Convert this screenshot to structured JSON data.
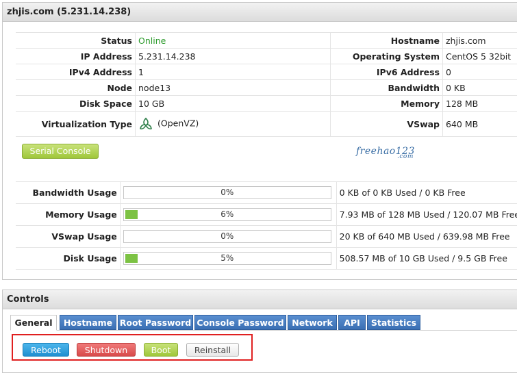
{
  "server_panel": {
    "title": "zhjis.com (5.231.14.238)"
  },
  "info": {
    "rows": [
      {
        "l1": "Status",
        "v1": "Online",
        "l2": "Hostname",
        "v2": "zhjis.com"
      },
      {
        "l1": "IP Address",
        "v1": "5.231.14.238",
        "l2": "Operating System",
        "v2": "CentOS 5 32bit"
      },
      {
        "l1": "IPv4 Address",
        "v1": "1",
        "l2": "IPv6 Address",
        "v2": "0"
      },
      {
        "l1": "Node",
        "v1": "node13",
        "l2": "Bandwidth",
        "v2": "0 KB"
      },
      {
        "l1": "Disk Space",
        "v1": "10 GB",
        "l2": "Memory",
        "v2": "128 MB"
      },
      {
        "l1": "Virtualization Type",
        "v1": "(OpenVZ)",
        "l2": "VSwap",
        "v2": "640 MB"
      }
    ],
    "status_color": "#2a9a2a"
  },
  "serial_console_label": "Serial Console",
  "watermark": {
    "main": "freehao123",
    "sub": ".com"
  },
  "usage": [
    {
      "label": "Bandwidth Usage",
      "percent": 0,
      "percent_text": "0%",
      "detail": "0 KB of 0 KB Used / 0 KB Free"
    },
    {
      "label": "Memory Usage",
      "percent": 6,
      "percent_text": "6%",
      "detail": "7.93 MB of 128 MB Used / 120.07 MB Free"
    },
    {
      "label": "VSwap Usage",
      "percent": 0,
      "percent_text": "0%",
      "detail": "20 KB of 640 MB Used / 639.98 MB Free"
    },
    {
      "label": "Disk Usage",
      "percent": 5,
      "percent_text": "5%",
      "detail": "508.57 MB of 10 GB Used / 9.5 GB Free"
    }
  ],
  "controls_panel": {
    "title": "Controls"
  },
  "tabs": [
    "General",
    "Hostname",
    "Root Password",
    "Console Password",
    "Network",
    "API",
    "Statistics"
  ],
  "actions": {
    "reboot": "Reboot",
    "shutdown": "Shutdown",
    "boot": "Boot",
    "reinstall": "Reinstall"
  },
  "colors": {
    "bar_fill": "#7cc243",
    "tab": "#3a6fb4",
    "highlight_box": "#e02020"
  },
  "icons": {
    "virtualization": "openvz-icon"
  }
}
